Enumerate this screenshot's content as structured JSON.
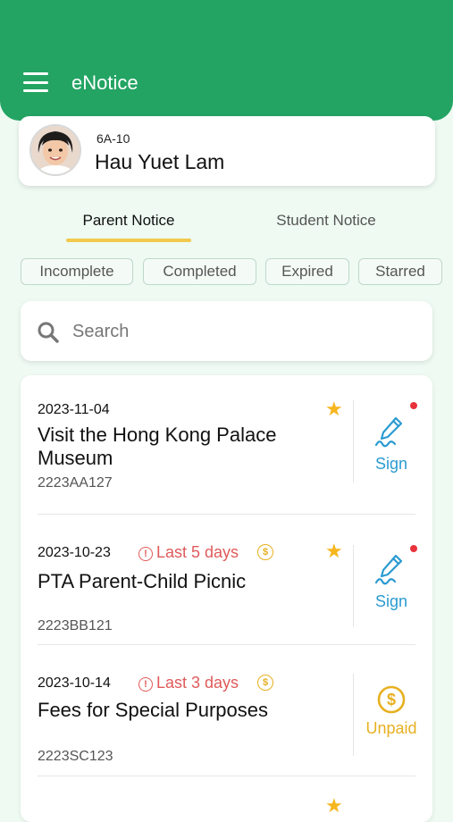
{
  "header": {
    "title": "eNotice",
    "menu_icon": "hamburger-menu-icon",
    "color": "#23a463"
  },
  "profile": {
    "class_no": "6A-10",
    "name": "Hau Yuet Lam"
  },
  "tabs": [
    {
      "label": "Parent Notice",
      "active": true
    },
    {
      "label": "Student Notice",
      "active": false
    }
  ],
  "filters": [
    "Incomplete",
    "Completed",
    "Expired",
    "Starred"
  ],
  "search": {
    "placeholder": "Search",
    "icon": "search-icon"
  },
  "notices": [
    {
      "date": "2023-11-04",
      "days_left": "",
      "has_fee": false,
      "title": "Visit the Hong Kong Palace Museum",
      "code": "2223AA127",
      "starred": true,
      "action": "Sign",
      "action_icon": "pen-sign-icon",
      "unread": true
    },
    {
      "date": "2023-10-23",
      "days_left": "Last 5 days",
      "has_fee": true,
      "title": "PTA Parent-Child Picnic",
      "code": "2223BB121",
      "starred": true,
      "action": "Sign",
      "action_icon": "pen-sign-icon",
      "unread": true
    },
    {
      "date": "2023-10-14",
      "days_left": "Last 3 days",
      "has_fee": true,
      "title": "Fees for Special Purposes",
      "code": "2223SC123",
      "starred": false,
      "action": "Unpaid",
      "action_icon": "dollar-coin-icon",
      "unread": false
    }
  ],
  "colors": {
    "accent": "#23a463",
    "tab_underline": "#f2c94c",
    "star": "#f6b61d",
    "sign": "#2b9bd1",
    "unpaid": "#e6b020",
    "warning": "#e05a5a",
    "dot": "#e8323c"
  }
}
